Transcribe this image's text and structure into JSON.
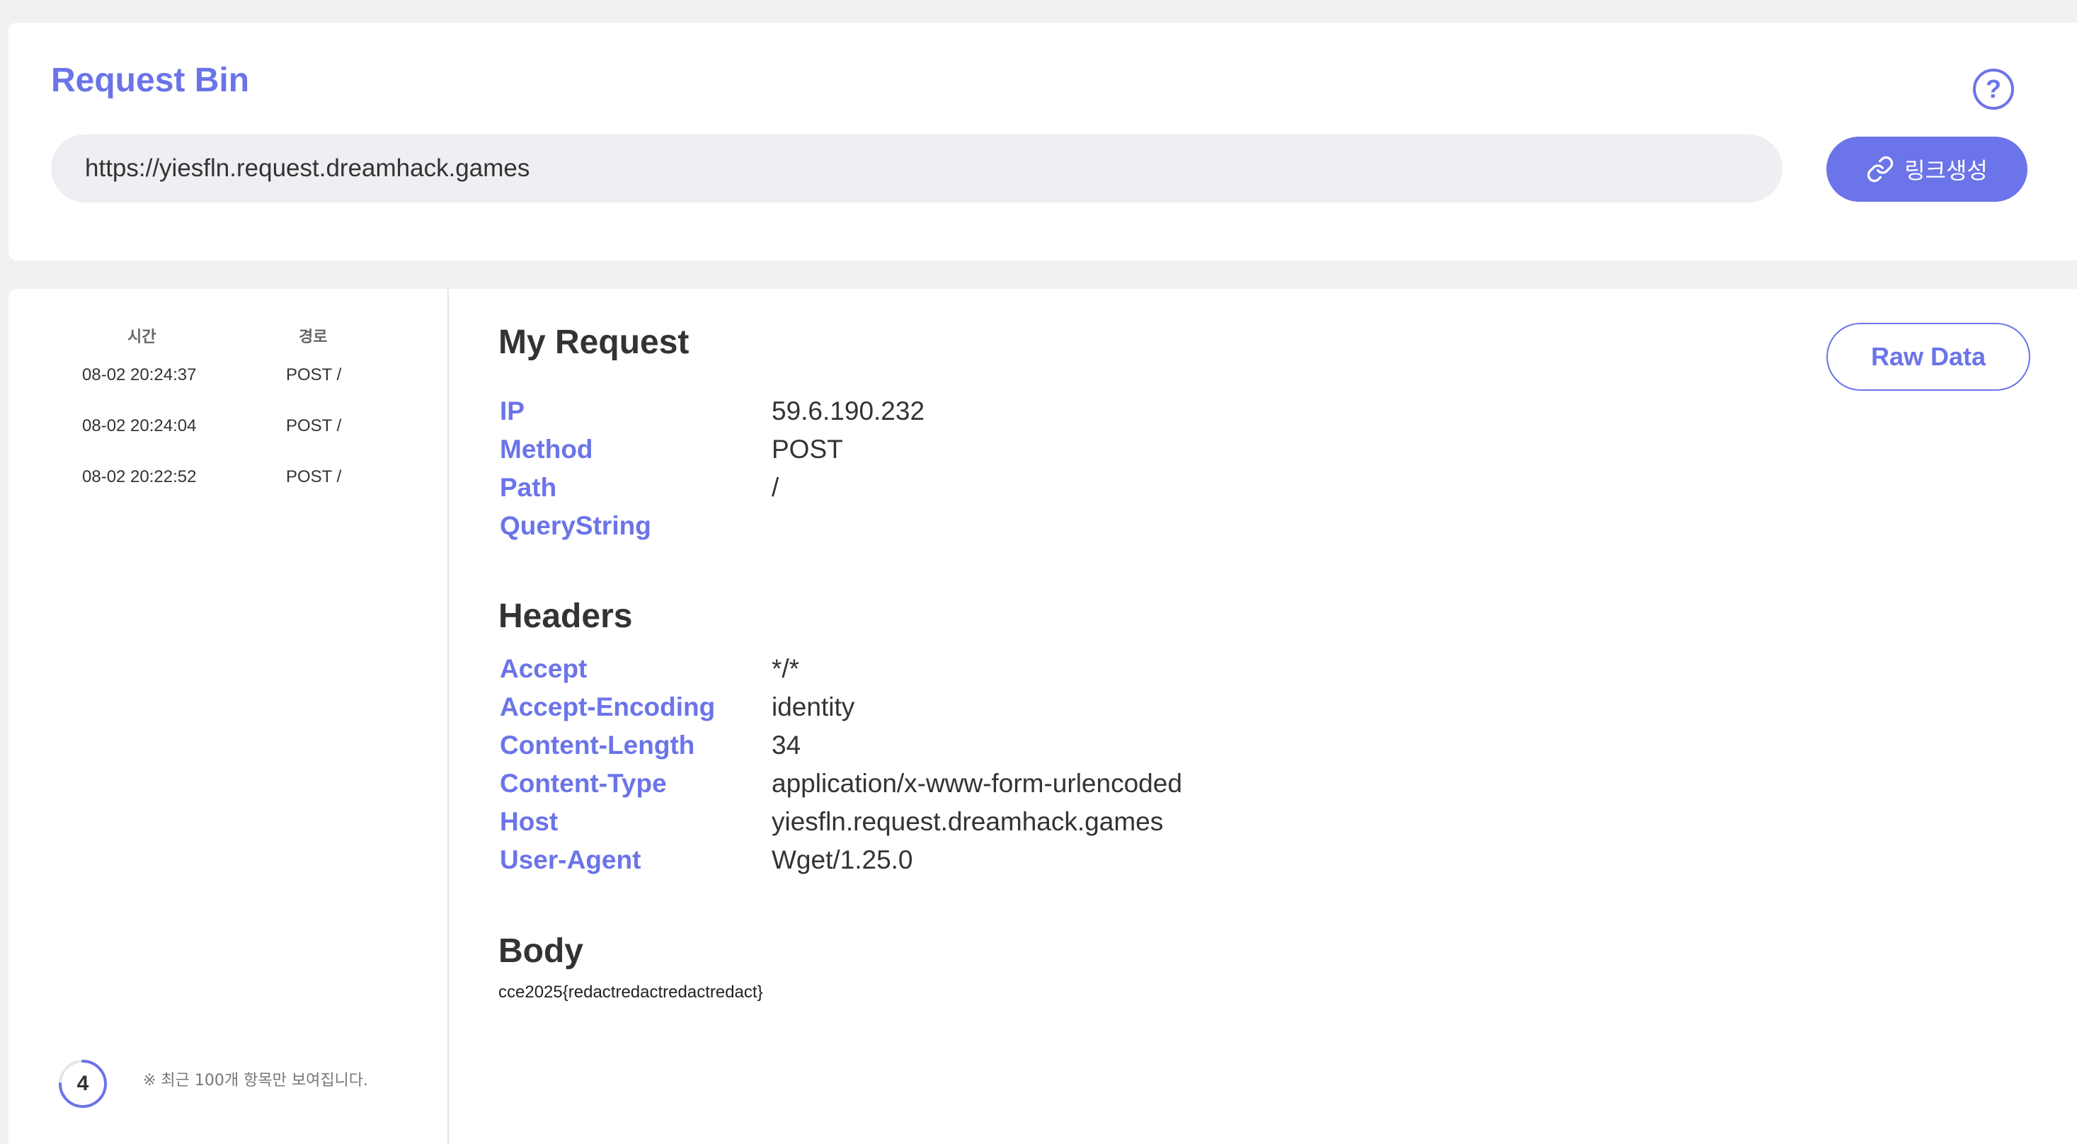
{
  "header": {
    "title": "Request Bin",
    "help_icon_label": "?",
    "url_value": "https://yiesfln.request.dreamhack.games",
    "create_link_label": "링크생성"
  },
  "request_list": {
    "columns": [
      "시간",
      "경로"
    ],
    "rows": [
      {
        "time": "08-02 20:24:37",
        "path": "POST /"
      },
      {
        "time": "08-02 20:24:04",
        "path": "POST /"
      },
      {
        "time": "08-02 20:22:52",
        "path": "POST /"
      }
    ],
    "count": "4",
    "footer_note": "※ 최근 100개 항목만 보여집니다."
  },
  "detail": {
    "title": "My Request",
    "raw_data_label": "Raw Data",
    "request": [
      {
        "key": "IP",
        "value": "59.6.190.232"
      },
      {
        "key": "Method",
        "value": "POST"
      },
      {
        "key": "Path",
        "value": "/"
      },
      {
        "key": "QueryString",
        "value": ""
      }
    ],
    "headers_title": "Headers",
    "headers": [
      {
        "key": "Accept",
        "value": "*/*"
      },
      {
        "key": "Accept-Encoding",
        "value": "identity"
      },
      {
        "key": "Content-Length",
        "value": "34"
      },
      {
        "key": "Content-Type",
        "value": "application/x-www-form-urlencoded"
      },
      {
        "key": "Host",
        "value": "yiesfln.request.dreamhack.games"
      },
      {
        "key": "User-Agent",
        "value": "Wget/1.25.0"
      }
    ],
    "body_title": "Body",
    "body": "cce2025{redactredactredactredact}"
  },
  "colors": {
    "accent": "#6b74e8",
    "background": "#f1f1f4",
    "card": "#ffffff"
  }
}
